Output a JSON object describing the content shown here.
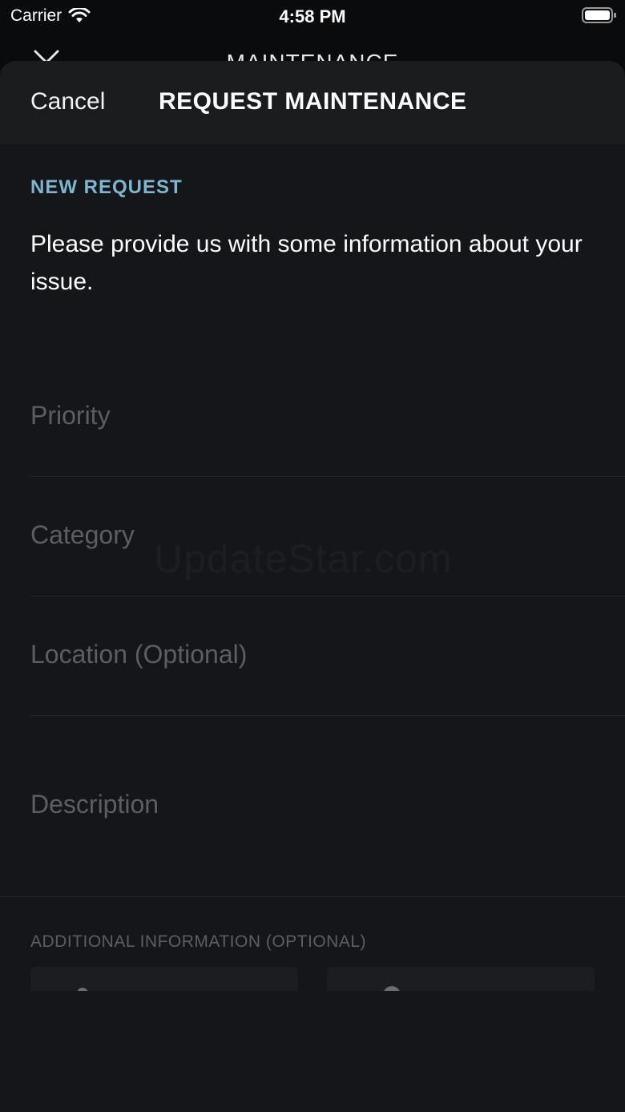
{
  "status_bar": {
    "carrier": "Carrier",
    "time": "4:58 PM"
  },
  "underlay": {
    "title": "MAINTENANCE"
  },
  "nav": {
    "cancel_label": "Cancel",
    "title": "REQUEST MAINTENANCE"
  },
  "form": {
    "section_label": "NEW REQUEST",
    "intro": "Please provide us with some information about your issue.",
    "priority_placeholder": "Priority",
    "category_placeholder": "Category",
    "location_placeholder": "Location (Optional)",
    "description_placeholder": "Description",
    "additional_label": "ADDITIONAL INFORMATION (OPTIONAL)"
  },
  "watermark": "UpdateStar.com",
  "colors": {
    "accent": "#7fb6cf",
    "background": "#141619",
    "placeholder": "#5b5f63"
  }
}
